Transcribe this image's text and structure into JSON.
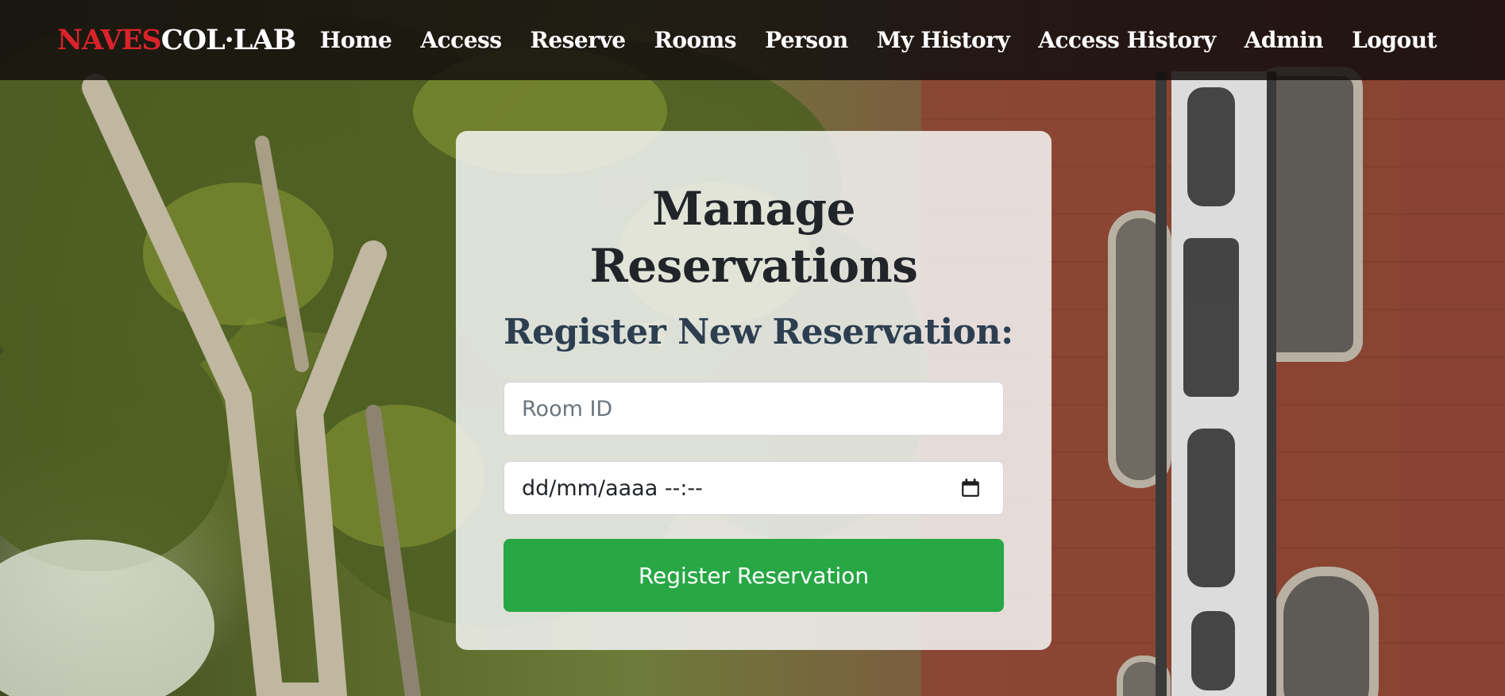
{
  "navbar": {
    "brand_red": "NAVES",
    "brand_white": "COL·LAB",
    "links": [
      {
        "label": "Home"
      },
      {
        "label": "Access"
      },
      {
        "label": "Reserve"
      },
      {
        "label": "Rooms"
      },
      {
        "label": "Person"
      },
      {
        "label": "My History"
      },
      {
        "label": "Access History"
      },
      {
        "label": "Admin"
      },
      {
        "label": "Logout"
      }
    ]
  },
  "card": {
    "title": "Manage Reservations",
    "subtitle": "Register New Reservation:",
    "room_id_placeholder": "Room ID",
    "room_id_value": "",
    "datetime_value": "dd/mm/aaaa --:--",
    "calendar_icon": "calendar-icon",
    "submit_label": "Register Reservation"
  },
  "colors": {
    "brand_accent": "#d9232a",
    "navbar_bg": "#140e0e",
    "submit_button": "#28a745",
    "title_text": "#212529",
    "subtitle_text": "#2c3e50"
  }
}
